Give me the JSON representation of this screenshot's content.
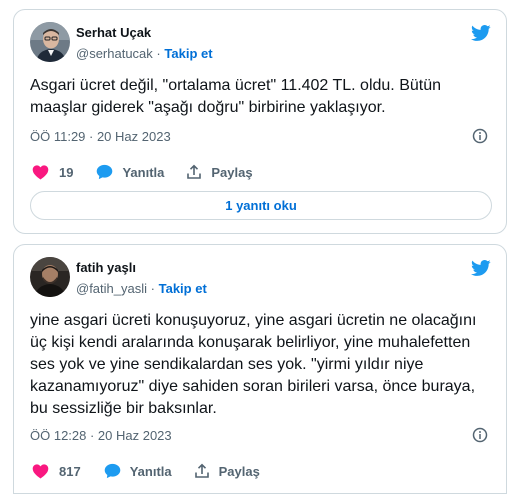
{
  "colors": {
    "accent": "#1d9bf0",
    "link": "#006fd6",
    "like": "#f91880",
    "muted": "#536471",
    "border": "#cfd9de"
  },
  "tweets": [
    {
      "author_name": "Serhat Uçak",
      "handle": "@serhatucak",
      "separator": "·",
      "follow_label": "Takip et",
      "text": "Asgari ücret değil, \"ortalama ücret\" 11.402 TL. oldu. Bütün maaşlar giderek \"aşağı doğru\" birbirine yaklaşıyor.",
      "timestamp": "ÖÖ 11:29 · 20 Haz 2023",
      "likes": "19",
      "reply_label": "Yanıtla",
      "share_label": "Paylaş",
      "read_replies_label": "1 yanıtı oku",
      "icons": [
        "twitter-bird-icon",
        "info-icon",
        "heart-icon",
        "reply-bubble-icon",
        "share-icon"
      ]
    },
    {
      "author_name": "fatih yaşlı",
      "handle": "@fatih_yasli",
      "separator": "·",
      "follow_label": "Takip et",
      "text": "yine asgari ücreti konuşuyoruz, yine asgari ücretin ne olacağını üç kişi kendi aralarında konuşarak belirliyor, yine muhalefetten ses yok ve yine sendikalardan ses yok. \"yirmi yıldır niye kazanamıyoruz\" diye sahiden soran birileri varsa, önce buraya, bu sessizliğe bir baksınlar.",
      "timestamp": "ÖÖ 12:28 · 20 Haz 2023",
      "likes": "817",
      "reply_label": "Yanıtla",
      "share_label": "Paylaş",
      "icons": [
        "twitter-bird-icon",
        "info-icon",
        "heart-icon",
        "reply-bubble-icon",
        "share-icon"
      ]
    }
  ]
}
